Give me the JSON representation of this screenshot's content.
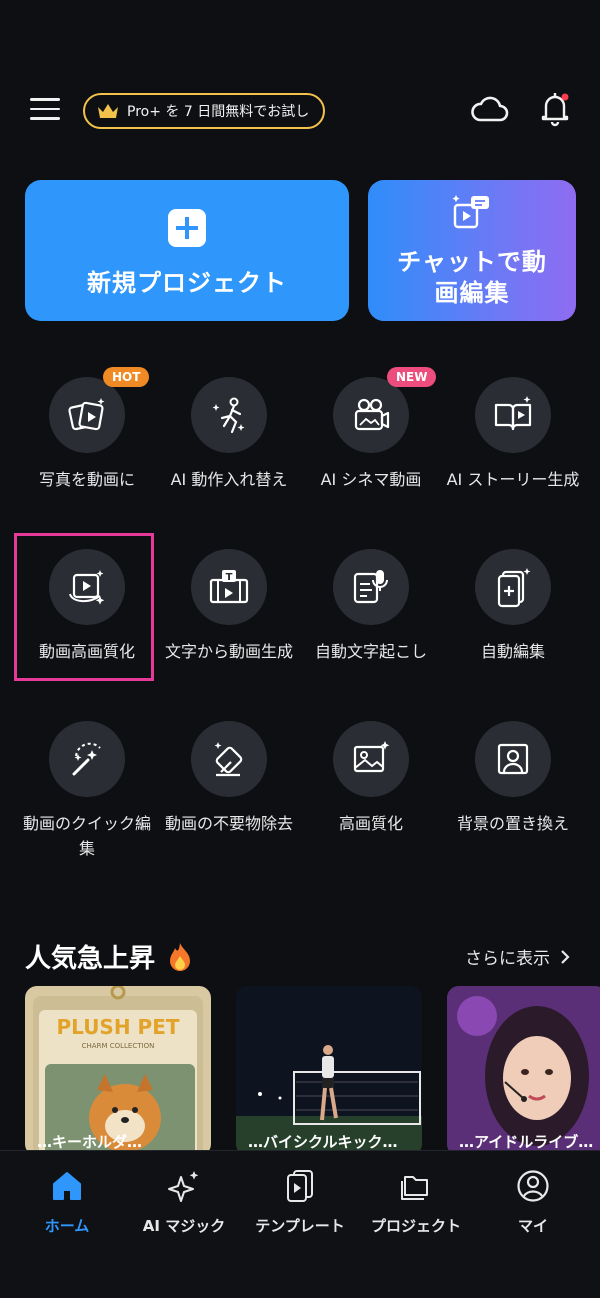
{
  "header": {
    "promo_text": "Pro+ を 7 日間無料でお試し",
    "icons": [
      "menu-icon",
      "crown-icon",
      "cloud-icon",
      "bell-icon"
    ],
    "accent_color": "#f2c24b",
    "notification_dot_color": "#ff3b4e"
  },
  "cards": {
    "new_project": "新規プロジェクト",
    "chat_edit_line1": "チャットで動",
    "chat_edit_line2": "画編集"
  },
  "tools": [
    {
      "label": "写真を動画に",
      "badge": "HOT",
      "icon": "photo-to-video-icon"
    },
    {
      "label": "AI 動作入れ替え",
      "icon": "motion-swap-icon"
    },
    {
      "label": "AI シネマ動画",
      "badge": "NEW",
      "icon": "cinema-camera-icon"
    },
    {
      "label": "AI ストーリー生成",
      "icon": "story-book-icon"
    },
    {
      "label": "動画高画質化",
      "icon": "video-enhance-icon"
    },
    {
      "label": "文字から動画生成",
      "icon": "text-to-video-icon"
    },
    {
      "label": "自動文字起こし",
      "icon": "transcription-icon"
    },
    {
      "label": "自動編集",
      "icon": "auto-edit-icon"
    },
    {
      "label": "動画のクイック編集",
      "icon": "magic-wand-icon"
    },
    {
      "label": "動画の不要物除去",
      "icon": "eraser-icon"
    },
    {
      "label": "高画質化",
      "icon": "image-enhance-icon"
    },
    {
      "label": "背景の置き換え",
      "icon": "background-replace-icon"
    }
  ],
  "trending": {
    "title": "人気急上昇",
    "more": "さらに表示",
    "items": [
      {
        "title_line1": "PLUSH PET",
        "title_line2": "CHARM COLLECTION",
        "caption": "…キーホルダ…"
      },
      {
        "caption": "…バイシクルキック…"
      },
      {
        "caption": "…アイドルライブ…"
      }
    ]
  },
  "nav": [
    {
      "label": "ホーム",
      "active": true,
      "icon": "home-icon"
    },
    {
      "label": "AI マジック",
      "icon": "sparkle-icon"
    },
    {
      "label": "テンプレート",
      "icon": "template-icon"
    },
    {
      "label": "プロジェクト",
      "icon": "folder-icon"
    },
    {
      "label": "マイ",
      "icon": "profile-icon"
    }
  ]
}
